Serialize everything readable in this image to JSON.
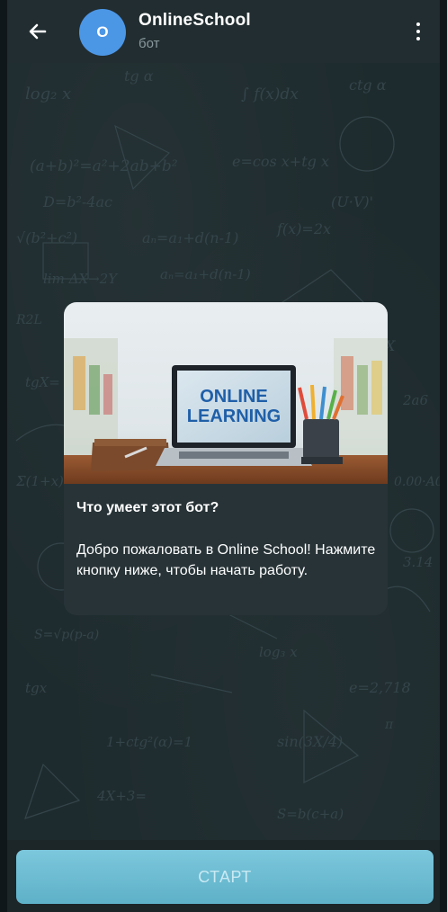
{
  "header": {
    "back_icon": "arrow-left-icon",
    "avatar_letter": "O",
    "title": "OnlineSchool",
    "subtitle": "бот",
    "menu_icon": "more-vertical-icon"
  },
  "message": {
    "image_text_line1": "ONLINE",
    "image_text_line2": "LEARNING",
    "heading": "Что умеет этот бот?",
    "body": "Добро пожаловать в Online School! Нажмите кнопку ниже, чтобы начать работу."
  },
  "bottom": {
    "start_label": "СТАРТ"
  },
  "colors": {
    "avatar": "#4c96e6",
    "start_button": "#6bbbd2",
    "chat_background": "#1e2b2e",
    "card_background": "#273337"
  }
}
